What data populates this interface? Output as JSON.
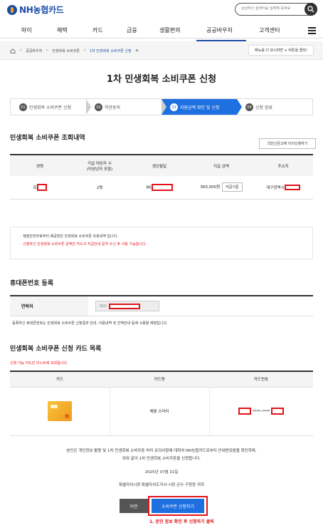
{
  "header": {
    "logo_text": "NH농협카드",
    "search_placeholder": "궁금하신 검색어를 입력해 보세요",
    "gnb": [
      "마이",
      "혜택",
      "카드",
      "금융",
      "생활편의",
      "공공바우처",
      "고객센터"
    ]
  },
  "breadcrumb": {
    "items": [
      "공공바우처",
      "민생회복 소비쿠폰",
      "1차 민생회복 소비쿠폰 신청"
    ],
    "tip": "메뉴를 더 보시려면 + 버튼을 클릭!"
  },
  "page_title": "1차 민생회복 소비쿠폰 신청",
  "steps": [
    {
      "num": "01",
      "label": "민생회복 소비쿠폰 신청"
    },
    {
      "num": "02",
      "label": "약관동의"
    },
    {
      "num": "03",
      "label": "지원금액 확인 및 신청"
    },
    {
      "num": "04",
      "label": "신청 완료"
    }
  ],
  "lookup": {
    "title": "민생회복 소비쿠폰 조회내역",
    "appeal_button": "국민신문고에 이의신청하기",
    "headers": [
      "성명",
      "지급 대상자 수\n(미성년자 포함)",
      "생년월일",
      "지급 금액",
      "주소지"
    ],
    "row": {
      "name_prefix": "김",
      "count": "2명",
      "birth_prefix": "86",
      "amount": "360,000원",
      "amount_btn": "지급기준",
      "address_prefix": "대구광역시"
    }
  },
  "notice": [
    "행정안전부로부터 제공받은 민생회복 소비쿠폰 조회내역 입니다.",
    "신청하신 민생회복 소비쿠폰 금액은 카드사 지급안내 문자 수신 후 사용 가능합니다."
  ],
  "phone": {
    "title": "휴대폰번호 등록",
    "label": "연락처",
    "value_prefix": "010",
    "note": "· 등록하신 휴대폰번호는 민생회복 소비쿠폰 신청결과 안내, 이용내역 및 잔액안내 등에 사용될 예정입니다."
  },
  "cards": {
    "title": "민생회복 소비쿠폰 신청 카드 목록",
    "note": "신청 가능 카드만 리스트에 조회됩니다.",
    "headers": [
      "카드",
      "카드명",
      "카드번호"
    ],
    "row": {
      "card_name": "채움 스마티",
      "card_number_mid": "****-****"
    }
  },
  "agreement": {
    "line1": "본인은 개인정보 활용 및 1차 민생회복 소비쿠폰 처리 유의사항에 대하여 NH농협카드로부터 안내받았음을 확인하며,",
    "line2": "위와 같이 1차 민생회복 소비쿠폰을 신청합니다.",
    "date": "2025년 07월 21일",
    "to": "특별자치시장·특별자치도지사·시장·군수·구청장 귀하"
  },
  "buttons": {
    "prev": "이전",
    "apply": "소비쿠폰 신청하기"
  },
  "annotation": "1. 본인 정보 확인 후 신청하기 클릭"
}
